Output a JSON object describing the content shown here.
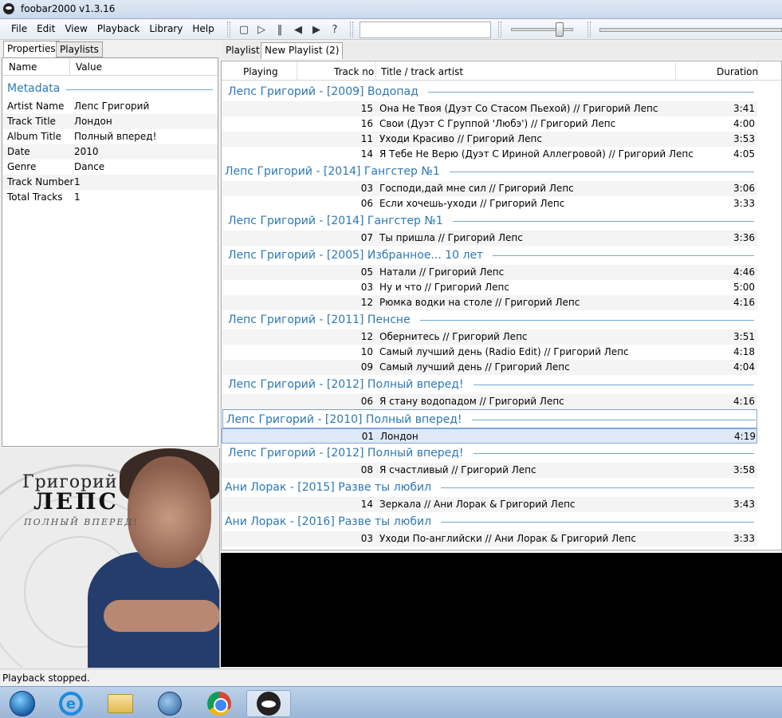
{
  "window": {
    "title": "foobar2000 v1.3.16"
  },
  "menu": [
    "File",
    "Edit",
    "View",
    "Playback",
    "Library",
    "Help"
  ],
  "toolbar": {
    "buttons": [
      "stop-icon",
      "play-icon",
      "pause-icon",
      "previous-icon",
      "next-icon",
      "random-icon"
    ],
    "search_value": ""
  },
  "left_tabs": [
    "Properties",
    "Playlists"
  ],
  "properties": {
    "columns": [
      "Name",
      "Value"
    ],
    "group": "Metadata",
    "rows": [
      {
        "k": "Artist Name",
        "v": "Лепс Григорий"
      },
      {
        "k": "Track Title",
        "v": "Лондон"
      },
      {
        "k": "Album Title",
        "v": "Полный вперед!"
      },
      {
        "k": "Date",
        "v": "2010"
      },
      {
        "k": "Genre",
        "v": "Dance"
      },
      {
        "k": "Track Number",
        "v": "1"
      },
      {
        "k": "Total Tracks",
        "v": "1"
      }
    ]
  },
  "album_art": {
    "line1": "Григорий",
    "line2": "ЛЕПС",
    "line3": "ПОЛНЫЙ ВПЕРЕД!"
  },
  "playlist_bar": {
    "label": "Playlist:",
    "current": "New Playlist (2)"
  },
  "playlist": {
    "columns": [
      "Playing",
      "Track no",
      "Title / track artist",
      "Duration"
    ],
    "groups": [
      {
        "title": "Лепс Григорий - [2009] Водопад",
        "tracks": [
          {
            "no": "15",
            "title": "Она Не Твоя (Дуэт Со Стасом Пьехой) // Григорий Лепс",
            "dur": "3:41"
          },
          {
            "no": "16",
            "title": "Свои (Дуэт С Группой 'Любэ') // Григорий Лепс",
            "dur": "4:00"
          },
          {
            "no": "11",
            "title": "Уходи Красиво // Григорий Лепс",
            "dur": "3:53"
          },
          {
            "no": "14",
            "title": "Я Тебе Не Верю (Дуэт С Ириной Аллегровой) // Григорий Лепс",
            "dur": "4:05"
          }
        ]
      },
      {
        "title": "Лепс Григорий - [2014] Гангстер №1",
        "tracks": [
          {
            "no": "03",
            "title": "Господи,дай мне сил // Григорий Лепс",
            "dur": "3:06"
          },
          {
            "no": "06",
            "title": "Если хочешь-уходи // Григорий Лепс",
            "dur": "3:33"
          }
        ]
      },
      {
        "title": "Лепс Григорий - [2014] Гангстер №1",
        "tracks": [
          {
            "no": "07",
            "title": "Ты пришла // Григорий Лепс",
            "dur": "3:36"
          }
        ]
      },
      {
        "title": "Лепс Григорий - [2005] Избранное... 10 лет",
        "tracks": [
          {
            "no": "05",
            "title": "Натали // Григорий Лепс",
            "dur": "4:46"
          },
          {
            "no": "03",
            "title": "Ну и что // Григорий Лепс",
            "dur": "5:00"
          },
          {
            "no": "12",
            "title": "Рюмка водки на столе // Григорий Лепс",
            "dur": "4:16"
          }
        ]
      },
      {
        "title": "Лепс Григорий - [2011] Пенсне",
        "tracks": [
          {
            "no": "12",
            "title": "Обернитесь // Григорий Лепс",
            "dur": "3:51"
          },
          {
            "no": "10",
            "title": "Самый лучший день (Radio Edit) // Григорий Лепс",
            "dur": "4:18"
          },
          {
            "no": "09",
            "title": "Самый лучший день // Григорий Лепс",
            "dur": "4:04"
          }
        ]
      },
      {
        "title": "Лепс Григорий - [2012] Полный вперед!",
        "tracks": [
          {
            "no": "06",
            "title": "Я стану водопадом // Григорий Лепс",
            "dur": "4:16"
          }
        ]
      },
      {
        "title": "Лепс Григорий - [2010] Полный вперед!",
        "selected": true,
        "tracks": [
          {
            "no": "01",
            "title": "Лондон",
            "dur": "4:19",
            "selected": true
          }
        ]
      },
      {
        "title": "Лепс Григорий - [2012] Полный вперед!",
        "tracks": [
          {
            "no": "08",
            "title": "Я счастливый // Григорий Лепс",
            "dur": "3:58"
          }
        ]
      },
      {
        "title": "Ани Лорак - [2015] Разве ты любил",
        "tracks": [
          {
            "no": "14",
            "title": "Зеркала // Ани Лорак & Григорий Лепс",
            "dur": "3:43"
          }
        ]
      },
      {
        "title": "Ани Лорак - [2016] Разве ты любил",
        "tracks": [
          {
            "no": "03",
            "title": "Уходи По-английски // Ани Лорак & Григорий Лепс",
            "dur": "3:33"
          }
        ]
      }
    ]
  },
  "status": "Playback stopped.",
  "taskbar": [
    "start-orb-icon",
    "internet-explorer-icon",
    "file-explorer-icon",
    "thunderbird-icon",
    "chrome-icon",
    "foobar2000-icon"
  ],
  "colors": {
    "group_title": "#2c78b5",
    "selection": "#dde9f6"
  }
}
